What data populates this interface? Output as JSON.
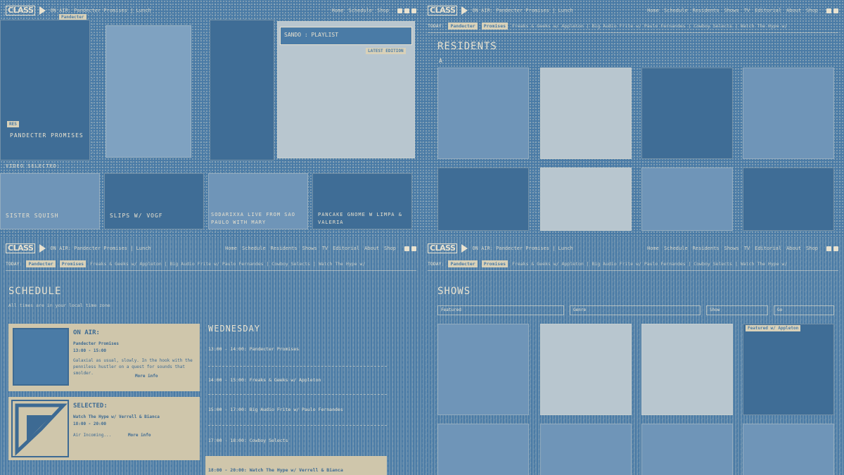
{
  "quad1": {
    "hero_playlist_label": "SANDO : PLAYLIST",
    "hero_badge": "LATEST EDITION",
    "residents_tag": "RES",
    "resident_name": "PANDECTER PROMISES",
    "video_selected_label": "VIDEO SELECTED:",
    "videos": [
      {
        "title": "SISTER SQUISH"
      },
      {
        "title": "SLIPS W/ VOGF"
      },
      {
        "title": "SODARIXXA LIVE FROM SAO PAULO WITH MARY"
      },
      {
        "title": "PANCAKE GNOME W LIMPA & VALERIA"
      }
    ]
  },
  "nav": {
    "logo": "CLASS",
    "onair_text": "ON AIR: Pandecter Promises | Lunch",
    "menu": [
      "Home",
      "Schedule",
      "Residents",
      "Shows",
      "TV",
      "Editorial",
      "About",
      "Shop"
    ],
    "subbar_today": "TODAY:",
    "subbar_chips": [
      "Pandecter",
      "Promises"
    ],
    "ticker": "Freaks & Geeks w/ Appleton | Big Audio Frite w/ Paulo Fernandes | Cowboy Selects | Watch The Hype w/"
  },
  "quad2": {
    "page_title": "RESIDENTS",
    "letter": "A"
  },
  "quad3": {
    "page_title": "SCHEDULE",
    "timezone_note": "All times are in your local time zone",
    "onair_panel": {
      "title": "ON AIR:",
      "show": "Pandecter Promises",
      "time": "13:00 - 15:00",
      "desc": "Galaxial as usual, slowly. In the hook with the penniless hustler on a quest for sounds that smolder.",
      "more": "More info"
    },
    "selected_panel": {
      "title": "SELECTED:",
      "show": "Watch The Hype w/ Verrell & Bianca",
      "time": "18:00 - 20:00",
      "desc": "Air Incoming...",
      "more": "More info"
    },
    "day": "WEDNESDAY",
    "rows": [
      "13:00 - 14:00: Pandecter Promises",
      "14:00 - 15:00: Freaks & Geeks w/ Appleton",
      "15:00 - 17:00: Big Audio Frite w/ Paulo Fernandes",
      "17:00 - 18:00: Cowboy Selects",
      "18:00 - 20:00: Watch The Hype w/ Verrell & Bianca"
    ]
  },
  "quad4": {
    "page_title": "SHOWS",
    "filters": [
      "Featured",
      "Genre",
      "Show",
      "Go"
    ],
    "card_tag": "Featured w/ Appleton"
  }
}
